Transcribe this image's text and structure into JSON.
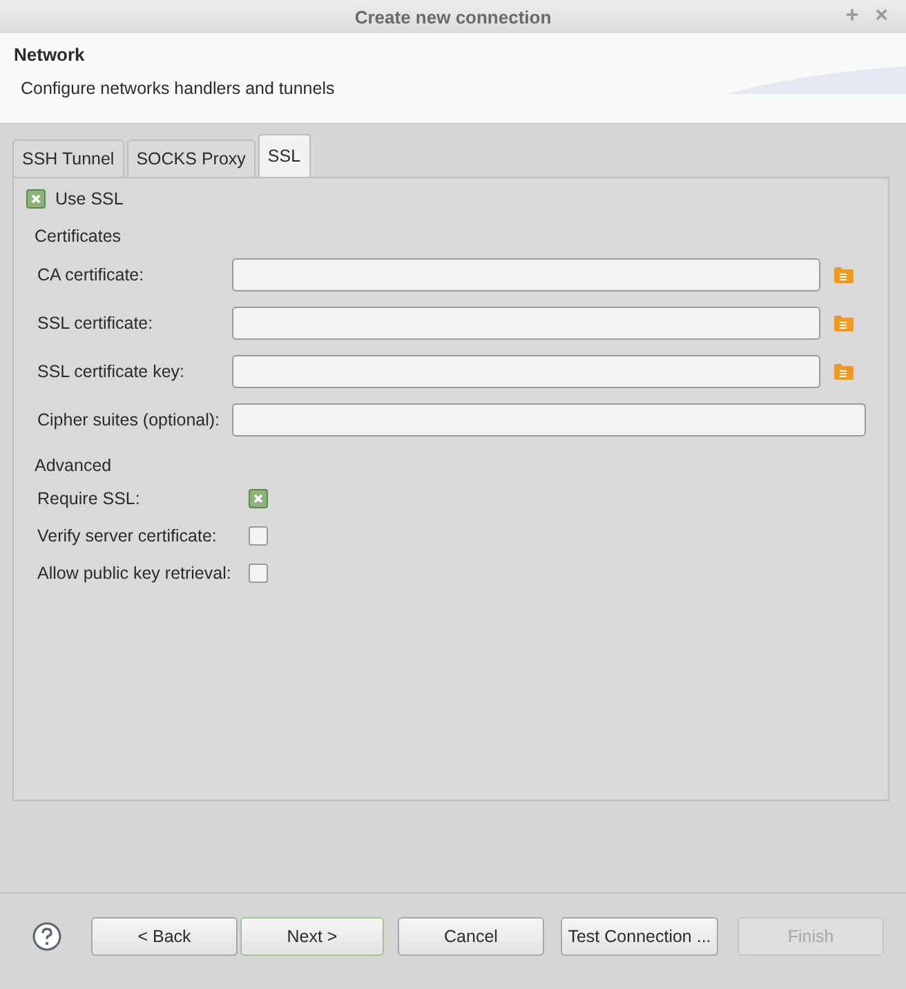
{
  "window": {
    "title": "Create new connection",
    "controls": [
      "+",
      "×"
    ]
  },
  "header": {
    "title": "Network",
    "description": "Configure networks handlers and tunnels"
  },
  "tabs": [
    {
      "label": "SSH Tunnel",
      "selected": false
    },
    {
      "label": "SOCKS Proxy",
      "selected": false
    },
    {
      "label": "SSL",
      "selected": true
    }
  ],
  "use_ssl": {
    "label": "Use SSL",
    "checked": true
  },
  "certificates": {
    "heading": "Certificates",
    "fields": [
      {
        "label": "CA certificate:",
        "kind": "file"
      },
      {
        "label": "SSL certificate:",
        "kind": "file"
      },
      {
        "label": "SSL certificate key:",
        "kind": "file"
      },
      {
        "label": "Cipher suites (optional):",
        "kind": "text"
      }
    ]
  },
  "advanced": {
    "heading": "Advanced",
    "options": [
      {
        "label": "Require SSL:",
        "checked": true
      },
      {
        "label": "Verify server certificate:",
        "checked": false
      },
      {
        "label": "Allow public key retrieval:",
        "checked": false
      }
    ]
  },
  "buttons": [
    {
      "label": "< Back",
      "default": false,
      "disabled": false
    },
    {
      "label": "Next >",
      "default": true,
      "disabled": false
    },
    {
      "label": "Cancel",
      "default": false,
      "disabled": false
    },
    {
      "label": "Test Connection ...",
      "default": false,
      "disabled": false
    },
    {
      "label": "Finish",
      "default": false,
      "disabled": true
    }
  ]
}
